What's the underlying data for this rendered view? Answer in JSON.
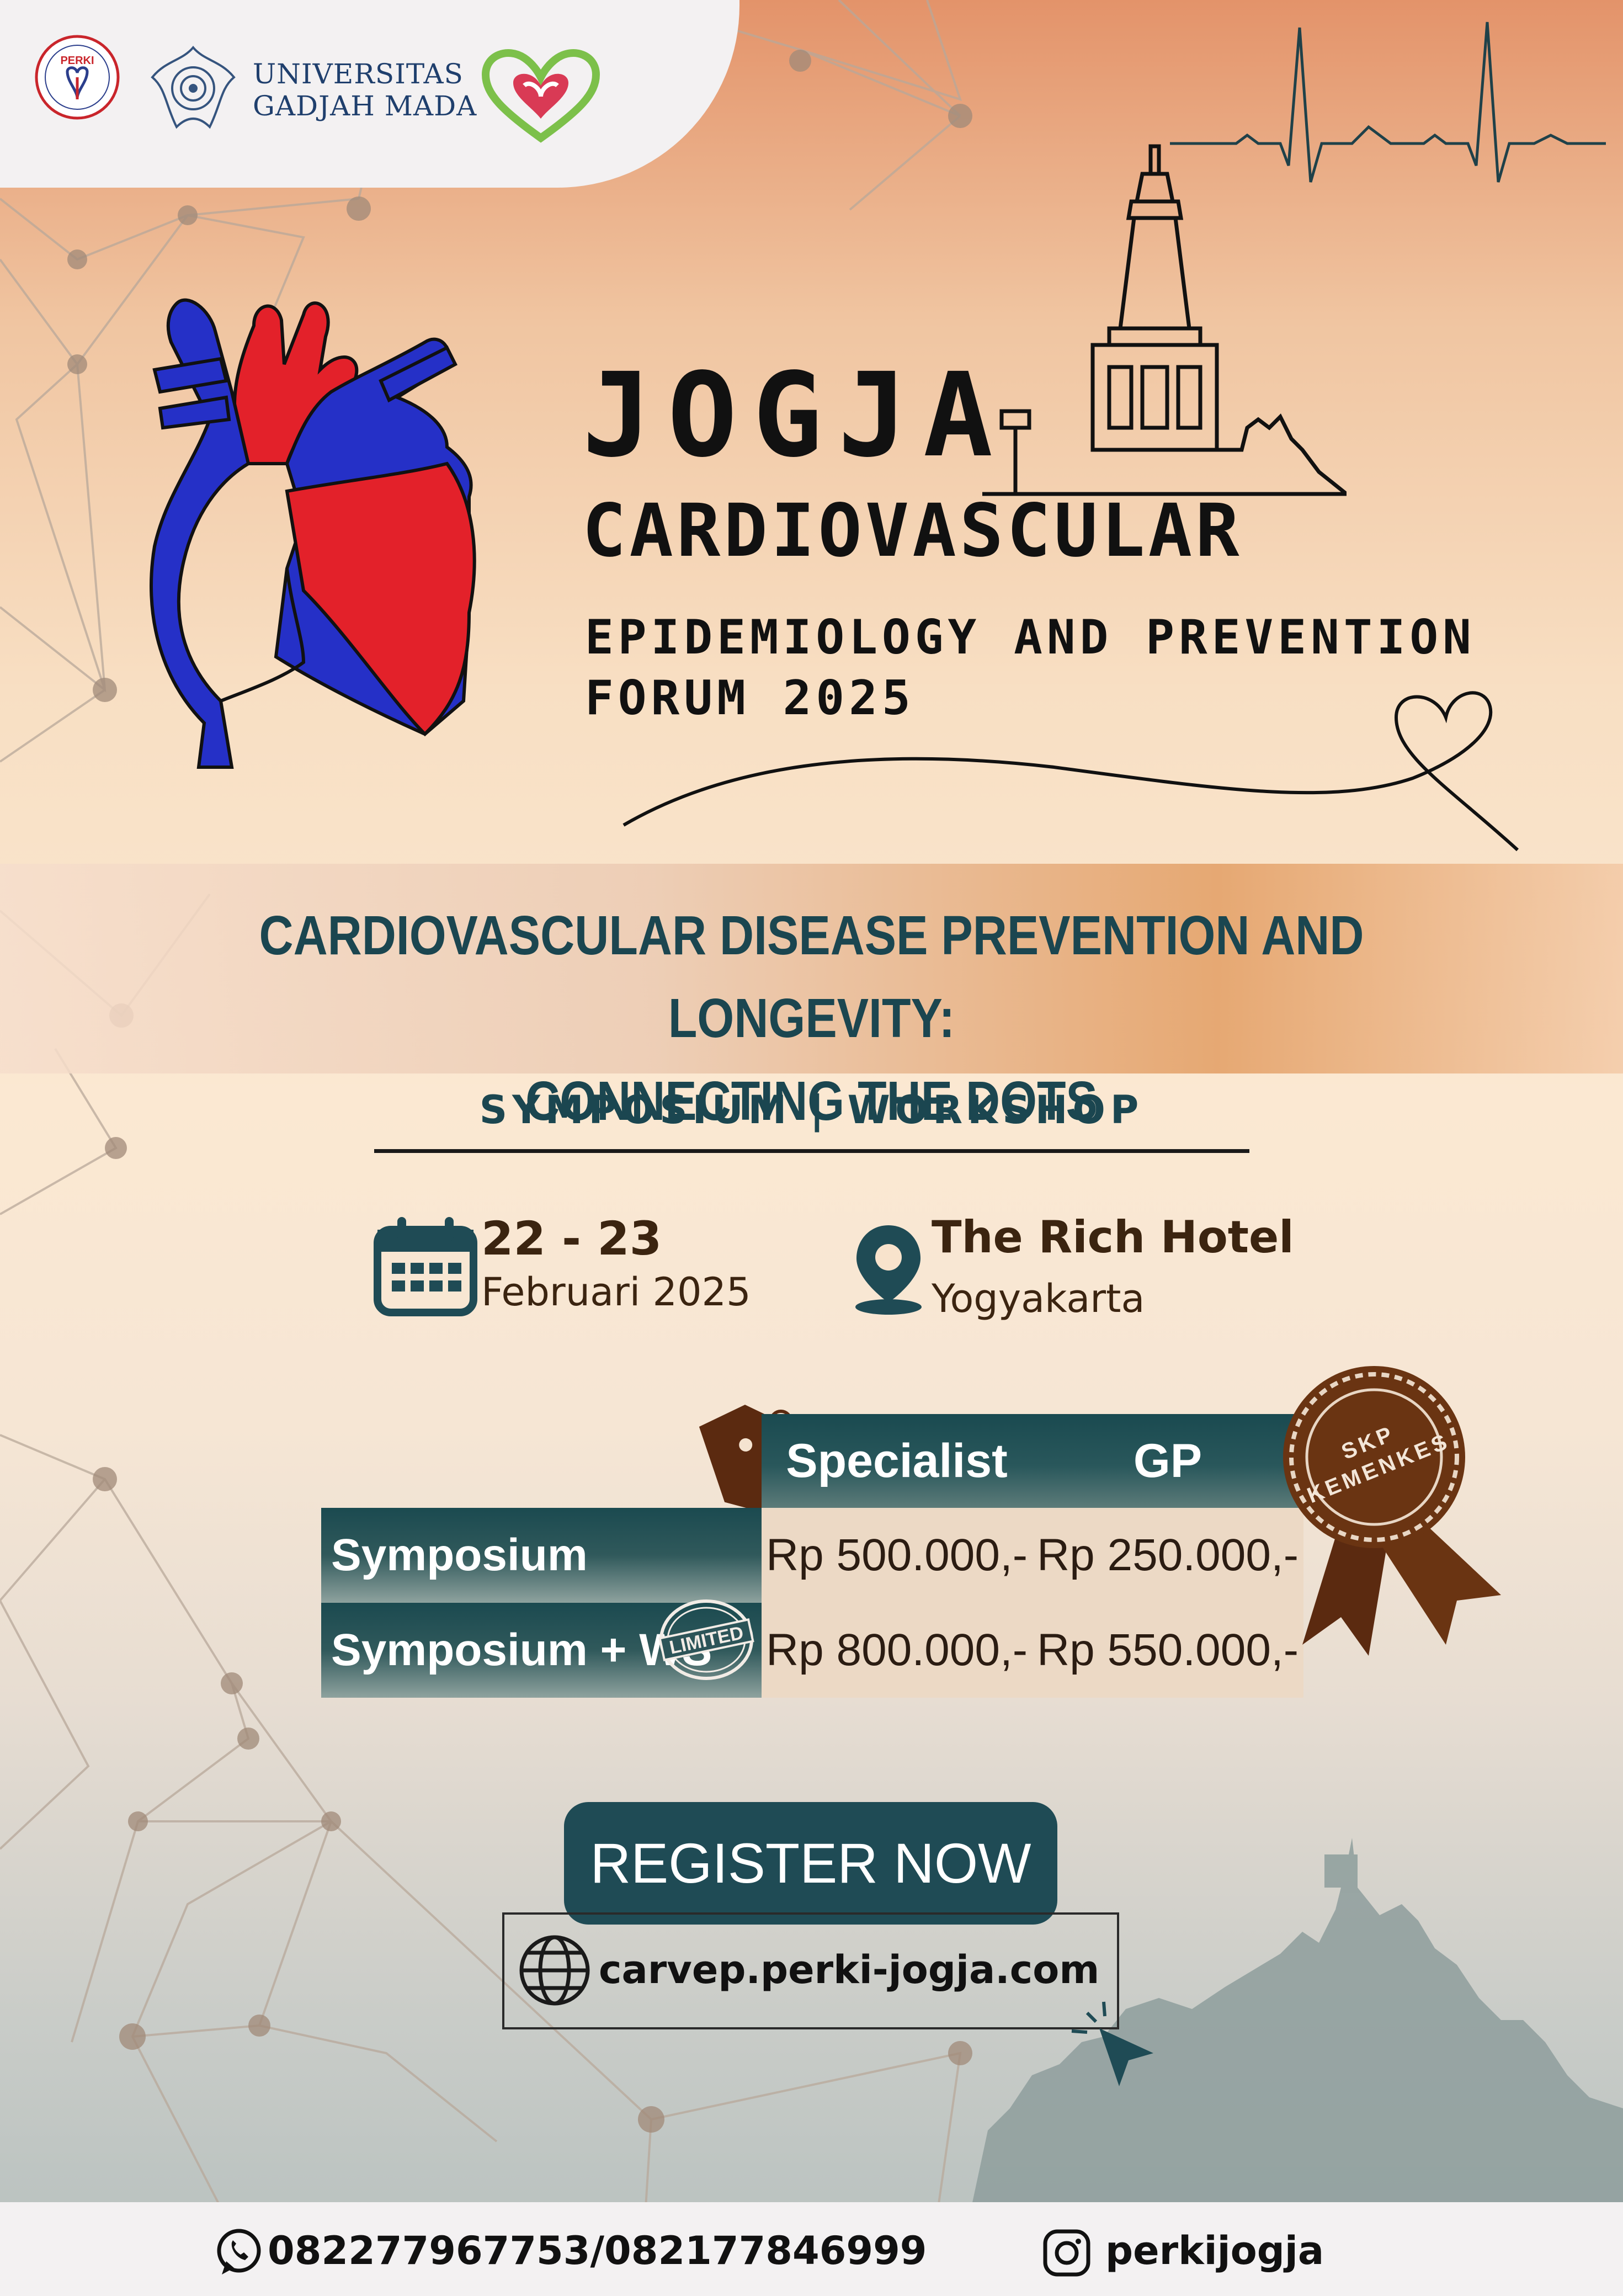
{
  "header": {
    "university_line1": "UNIVERSITAS",
    "university_line2": "GADJAH MADA",
    "perki_logo_text": "PERKI",
    "perki_ring_text": "PERHIMPUNAN DOKTER SPESIALIS KARDIOVASKULAR INDONESIA"
  },
  "title": {
    "line1": "JOGJA",
    "line2": "CARDIOVASCULAR",
    "line3": "EPIDEMIOLOGY AND PREVENTION",
    "line4": "FORUM 2025"
  },
  "theme": {
    "line1": "CARDIOVASCULAR DISEASE PREVENTION AND LONGEVITY:",
    "line2": "CONNECTING THE DOTS"
  },
  "format": "SYMPOSIUM  |  WORKSHOP",
  "event": {
    "date_main": "22 - 23",
    "date_sub": "Februari 2025",
    "venue_main": "The Rich Hotel",
    "venue_sub": "Yogyakarta"
  },
  "pricing": {
    "columns": [
      "Specialist",
      "GP"
    ],
    "rows": [
      {
        "label": "Symposium",
        "prices": [
          "Rp 500.000,-",
          "Rp 250.000,-"
        ]
      },
      {
        "label": "Symposium + WS",
        "prices": [
          "Rp 800.000,-",
          "Rp 550.000,-"
        ]
      }
    ],
    "limited_stamp": "LIMITED",
    "skp_badge_line1": "SKP",
    "skp_badge_line2": "KEMENKES"
  },
  "register": {
    "button_label": "REGISTER NOW",
    "url": "carvep.perki-jogja.com"
  },
  "footer": {
    "phones": "082277967753/082177846999",
    "instagram": "perkijogja"
  },
  "colors": {
    "teal": "#1f4b55",
    "brown": "#5b2a10",
    "heart_red": "#e3212a",
    "heart_blue": "#2530c7"
  }
}
